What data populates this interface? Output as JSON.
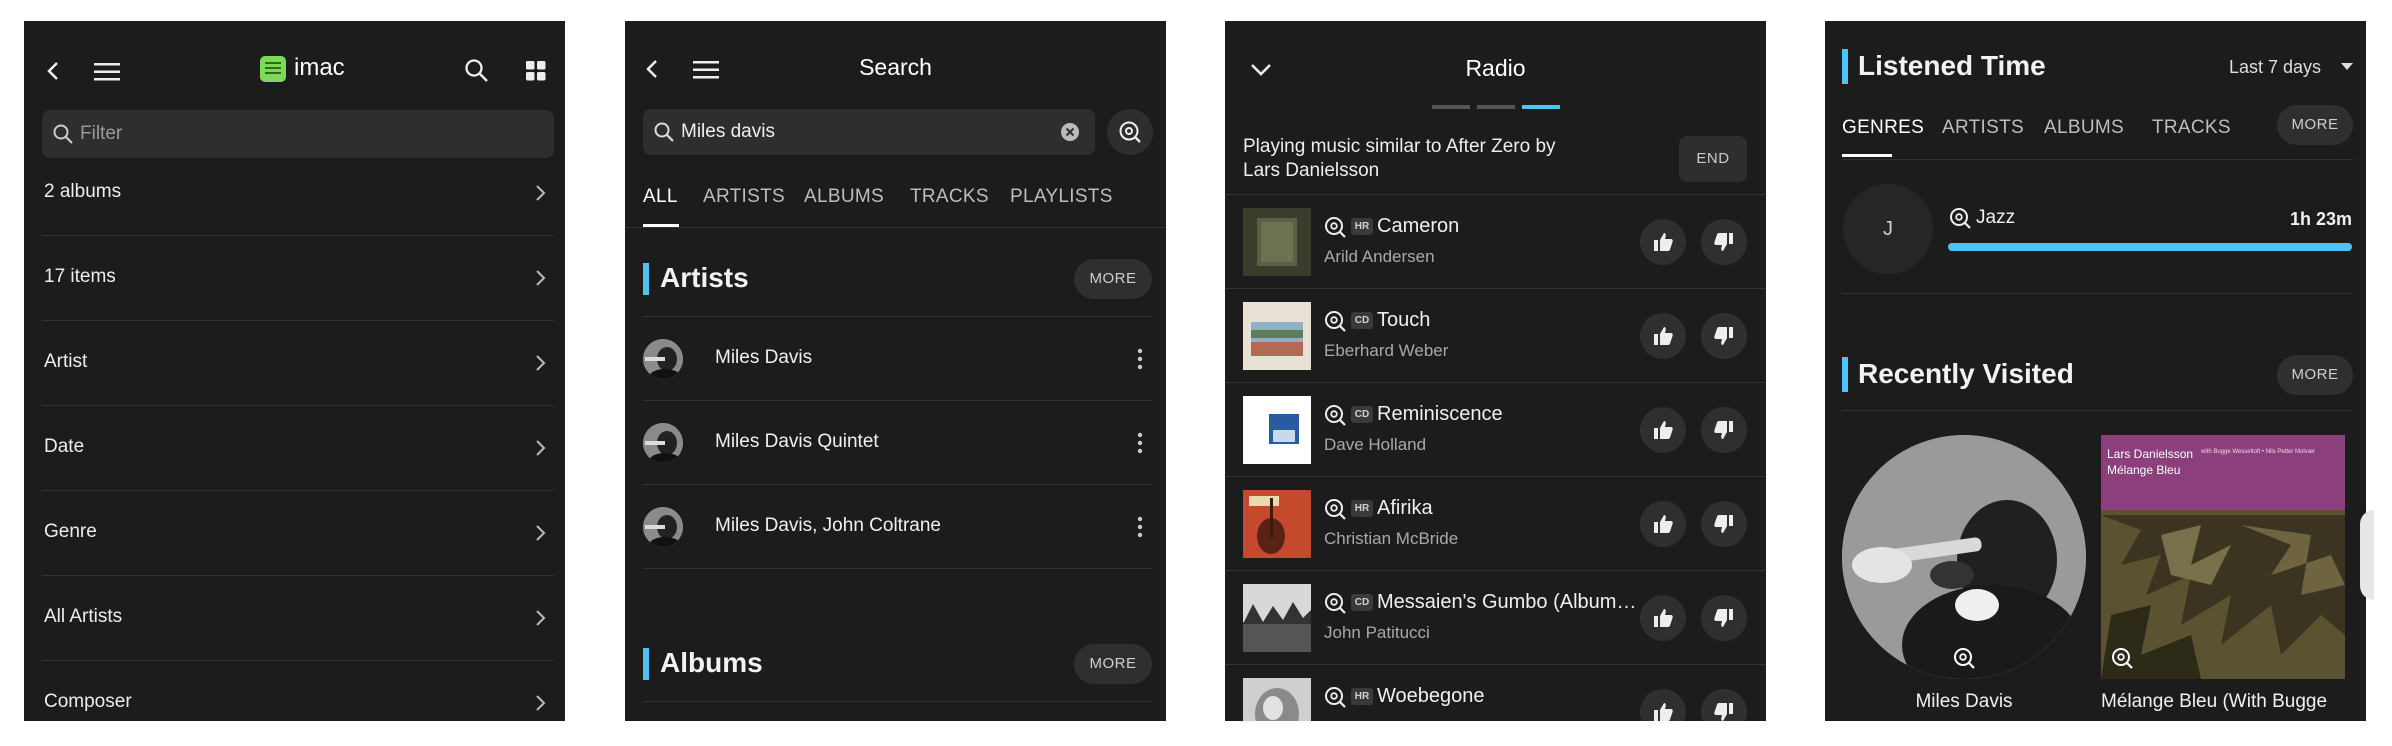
{
  "panel1": {
    "title": "imac",
    "filter_placeholder": "Filter",
    "rows": [
      "2 albums",
      "17 items",
      "Artist",
      "Date",
      "Genre",
      "All Artists",
      "Composer"
    ]
  },
  "panel2": {
    "title": "Search",
    "search_value": "Miles davis",
    "tabs": [
      "ALL",
      "ARTISTS",
      "ALBUMS",
      "TRACKS",
      "PLAYLISTS"
    ],
    "artists_heading": "Artists",
    "more_label": "MORE",
    "artists": [
      "Miles Davis",
      "Miles Davis Quintet",
      "Miles Davis, John Coltrane"
    ],
    "albums_heading": "Albums"
  },
  "panel3": {
    "title": "Radio",
    "similar_line1": "Playing music similar to After Zero by",
    "similar_line2": "Lars Danielsson",
    "end_label": "END",
    "tracks": [
      {
        "title": "Cameron",
        "artist": "Arild Andersen",
        "badge": "HR"
      },
      {
        "title": "Touch",
        "artist": "Eberhard Weber",
        "badge": "CD"
      },
      {
        "title": "Reminiscence",
        "artist": "Dave Holland",
        "badge": "CD"
      },
      {
        "title": "Afirika",
        "artist": "Christian McBride",
        "badge": "HR"
      },
      {
        "title": "Messaien's Gumbo (Album…",
        "artist": "John Patitucci",
        "badge": "CD"
      },
      {
        "title": "Woebegone",
        "artist": "",
        "badge": "HR"
      }
    ]
  },
  "panel4": {
    "listened_heading": "Listened Time",
    "range_label": "Last 7 days",
    "tabs": [
      "GENRES",
      "ARTISTS",
      "ALBUMS",
      "TRACKS"
    ],
    "more_label": "MORE",
    "genre_initial": "J",
    "genre_name": "Jazz",
    "genre_time": "1h 23m",
    "genre_progress": 1.0,
    "recent_heading": "Recently Visited",
    "recent_items": [
      {
        "label": "Miles Davis"
      },
      {
        "label": "Mélange Bleu (With Bugge",
        "cover_line1": "Lars Danielsson",
        "cover_line2": "Mélange Bleu",
        "cover_line3": "with Bugge Wesseltoft • Nils Petter Molvær"
      }
    ]
  },
  "colors": {
    "accent": "#4fc3f7",
    "panel_bg": "#1c1c1c",
    "logo_green": "#7ed957"
  }
}
